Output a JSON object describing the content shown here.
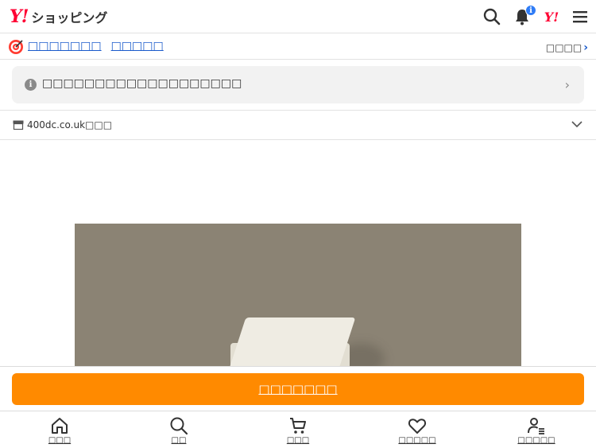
{
  "header": {
    "logo_y": "Y!",
    "logo_text": "ショッピング",
    "notification_badge": "i",
    "yahoo_mark": "Y!"
  },
  "promo": {
    "link_text_1": "□□□□□□□",
    "link_text_2": "□□□□□",
    "more_label": "□□□□",
    "more_chevron": "›"
  },
  "notice": {
    "icon_glyph": "i",
    "text": "□□□□□□□□□□□□□□□□□□□",
    "chevron": "›"
  },
  "store": {
    "name": "400dc.co.uk□□□"
  },
  "cart": {
    "button_label": "□□□□□□□"
  },
  "bottom_nav": {
    "items": [
      {
        "label": "□□□",
        "icon": "home-icon"
      },
      {
        "label": "□□",
        "icon": "search-icon"
      },
      {
        "label": "□□□",
        "icon": "cart-icon"
      },
      {
        "label": "□□□□□",
        "icon": "heart-icon"
      },
      {
        "label": "□□□□□",
        "icon": "user-list-icon"
      }
    ]
  },
  "colors": {
    "brand_red": "#ff0033",
    "link_blue": "#1a5bcb",
    "cart_orange": "#ff8a00",
    "product_bg": "#8b8374"
  }
}
